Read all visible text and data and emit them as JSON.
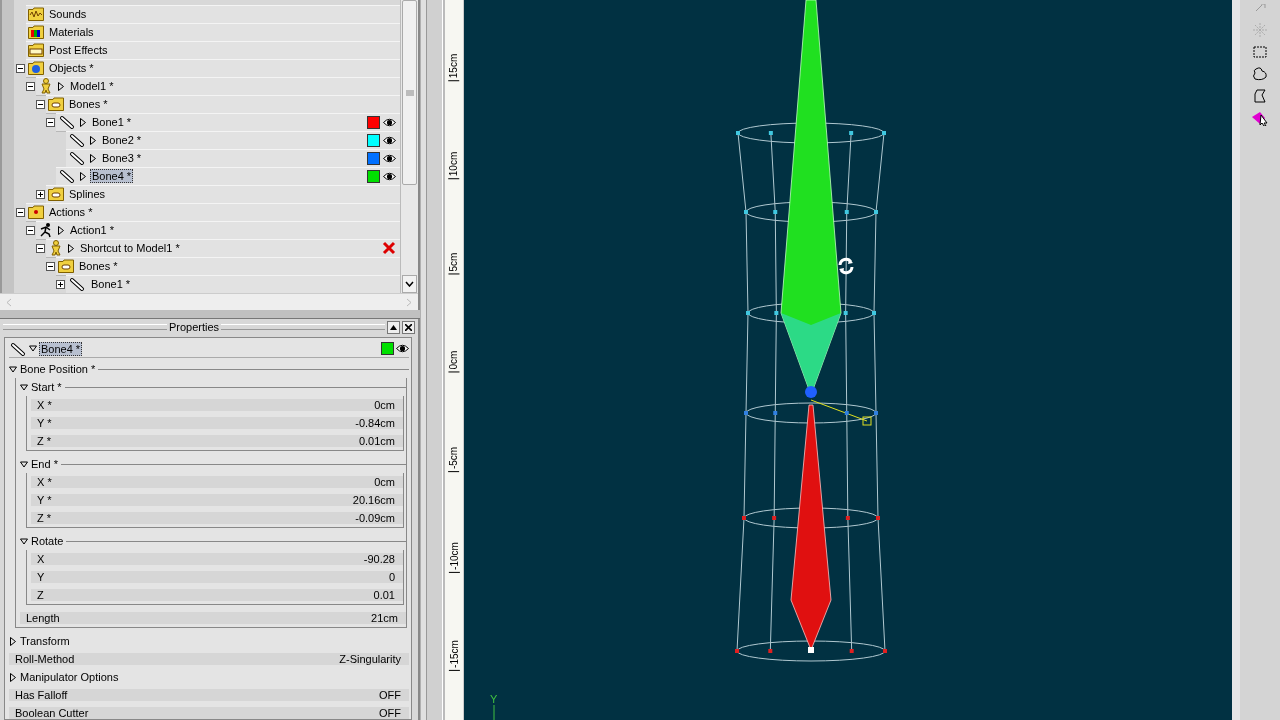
{
  "tree": {
    "items": [
      {
        "label": "Sounds",
        "kind": "sounds",
        "selected": false
      },
      {
        "label": "Materials",
        "kind": "materials",
        "selected": false
      },
      {
        "label": "Post Effects",
        "kind": "post",
        "selected": false
      },
      {
        "label": "Objects *",
        "kind": "objects",
        "expanded": true,
        "selected": false,
        "children": [
          {
            "label": "Model1 *",
            "kind": "figure",
            "expanded": true,
            "collapsible": true,
            "selected": false,
            "children": [
              {
                "label": "Bones *",
                "kind": "folder",
                "expanded": true,
                "selected": false,
                "children": [
                  {
                    "label": "Bone1 *",
                    "kind": "bone",
                    "expanded": true,
                    "collapsible": true,
                    "color": "#ff0000",
                    "visible": true,
                    "selected": false,
                    "children": [
                      {
                        "label": "Bone2 *",
                        "kind": "bone",
                        "collapsible": true,
                        "color": "#00ffff",
                        "visible": true,
                        "selected": false
                      },
                      {
                        "label": "Bone3 *",
                        "kind": "bone",
                        "collapsible": true,
                        "color": "#0070ff",
                        "visible": true,
                        "selected": false
                      }
                    ]
                  },
                  {
                    "label": "Bone4 *",
                    "kind": "bone",
                    "collapsible": true,
                    "color": "#00e000",
                    "visible": true,
                    "selected": true
                  }
                ]
              },
              {
                "label": "Splines",
                "kind": "folder",
                "expanded": false,
                "selected": false
              }
            ]
          }
        ]
      },
      {
        "label": "Actions *",
        "kind": "actions",
        "expanded": true,
        "selected": false,
        "children": [
          {
            "label": "Action1 *",
            "kind": "runner",
            "expanded": true,
            "collapsible": true,
            "selected": false,
            "children": [
              {
                "label": "Shortcut to Model1 *",
                "kind": "figure",
                "expanded": true,
                "collapsible": true,
                "crossed": true,
                "selected": false,
                "children": [
                  {
                    "label": "Bones *",
                    "kind": "folder",
                    "expanded": true,
                    "selected": false,
                    "children": [
                      {
                        "label": "Bone1 *",
                        "kind": "bone",
                        "expanded": false,
                        "selected": false
                      }
                    ]
                  }
                ]
              }
            ]
          }
        ]
      }
    ]
  },
  "properties": {
    "title": "Properties",
    "object": {
      "label": "Bone4 *",
      "expanded": true,
      "color": "#00e000",
      "visible": true
    },
    "items": [
      {
        "kind": "group",
        "label": "Bone Position *",
        "expanded": true,
        "children": [
          {
            "kind": "group",
            "label": "Start *",
            "expanded": true,
            "children": [
              {
                "kind": "field",
                "label": "X *",
                "value": "0cm"
              },
              {
                "kind": "field",
                "label": "Y *",
                "value": "-0.84cm"
              },
              {
                "kind": "field",
                "label": "Z *",
                "value": "0.01cm"
              }
            ]
          },
          {
            "kind": "group",
            "label": "End *",
            "expanded": true,
            "children": [
              {
                "kind": "field",
                "label": "X *",
                "value": "0cm"
              },
              {
                "kind": "field",
                "label": "Y *",
                "value": "20.16cm"
              },
              {
                "kind": "field",
                "label": "Z *",
                "value": "-0.09cm"
              }
            ]
          },
          {
            "kind": "group",
            "label": "Rotate",
            "expanded": true,
            "children": [
              {
                "kind": "field",
                "label": "X",
                "value": "-90.28"
              },
              {
                "kind": "field",
                "label": "Y",
                "value": "0"
              },
              {
                "kind": "field",
                "label": "Z",
                "value": "0.01"
              }
            ]
          },
          {
            "kind": "field",
            "label": "Length",
            "value": "21cm"
          }
        ]
      },
      {
        "kind": "group",
        "label": "Transform",
        "expanded": false
      },
      {
        "kind": "field",
        "label": "Roll-Method",
        "value": "Z-Singularity"
      },
      {
        "kind": "group",
        "label": "Manipulator Options",
        "expanded": false
      },
      {
        "kind": "field",
        "label": "Has Falloff",
        "value": "OFF"
      },
      {
        "kind": "field",
        "label": "Boolean Cutter",
        "value": "OFF"
      }
    ]
  },
  "ruler": {
    "labels": [
      "15cm",
      "10cm",
      "5cm",
      "0cm",
      "-5cm",
      "-10cm",
      "-15cm"
    ]
  },
  "viewport": {
    "axis_label": "Y"
  },
  "toolbar": {
    "tools": [
      {
        "kind": "pin"
      },
      {
        "kind": "sparkle"
      },
      {
        "kind": "rect"
      },
      {
        "kind": "lasso"
      },
      {
        "kind": "polygon"
      },
      {
        "kind": "pick"
      }
    ]
  }
}
